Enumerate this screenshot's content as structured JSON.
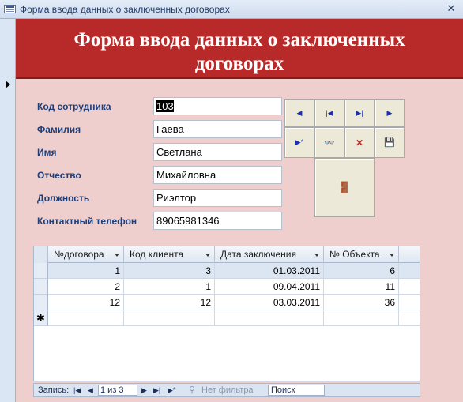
{
  "window": {
    "title": "Форма ввода данных о заключенных договорах",
    "close_glyph": "✕"
  },
  "header": {
    "title": "Форма ввода данных о заключенных договорах"
  },
  "fields": [
    {
      "label": "Код сотрудника",
      "value": "103"
    },
    {
      "label": "Фамилия",
      "value": "Гаева"
    },
    {
      "label": "Имя",
      "value": "Светлана"
    },
    {
      "label": "Отчество",
      "value": "Михайловна"
    },
    {
      "label": "Должность",
      "value": "Риэлтор"
    },
    {
      "label": "Контактный телефон",
      "value": "89065981346"
    }
  ],
  "nav_buttons": [
    {
      "icon": "prev-record-icon",
      "glyph": "◀"
    },
    {
      "icon": "first-record-icon",
      "glyph": "|◀"
    },
    {
      "icon": "last-record-icon",
      "glyph": "▶|"
    },
    {
      "icon": "next-record-icon",
      "glyph": "▶"
    },
    {
      "icon": "new-record-icon",
      "glyph": "▶*"
    },
    {
      "icon": "find-binoculars-icon",
      "glyph": "👓"
    },
    {
      "icon": "delete-record-icon",
      "glyph": "✕"
    },
    {
      "icon": "save-record-icon",
      "glyph": "💾"
    },
    {
      "icon": "exit-door-icon",
      "glyph": "🚪"
    }
  ],
  "table": {
    "columns": [
      "№договора",
      "Код клиента",
      "Дата заключения",
      "№ Объекта"
    ],
    "rows": [
      [
        "1",
        "3",
        "01.03.2011",
        "6"
      ],
      [
        "2",
        "1",
        "09.04.2011",
        "11"
      ],
      [
        "12",
        "12",
        "03.03.2011",
        "36"
      ]
    ],
    "new_row_marker": "✱"
  },
  "navigation": {
    "record_label": "Запись:",
    "record_position": "1 из 3",
    "filter_label": "Нет фильтра",
    "search_placeholder": "Поиск"
  },
  "colors": {
    "header_bg": "#b82a2a",
    "form_bg": "#eecfce",
    "label_text": "#1e3e78"
  }
}
